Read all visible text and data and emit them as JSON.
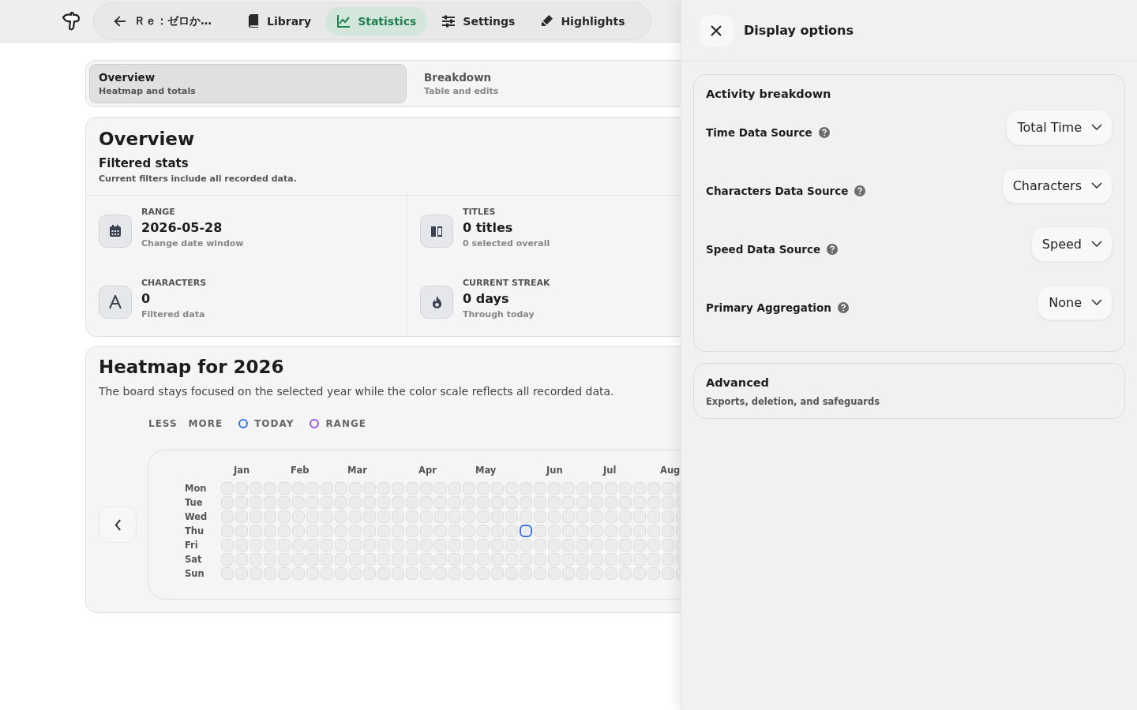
{
  "nav": {
    "back_title": "Ｒｅ：ゼロか…",
    "items": [
      {
        "label": "Library",
        "selected": false
      },
      {
        "label": "Statistics",
        "selected": true
      },
      {
        "label": "Settings",
        "selected": false
      },
      {
        "label": "Highlights",
        "selected": false
      }
    ]
  },
  "view_tabs": [
    {
      "title": "Overview",
      "subtitle": "Heatmap and totals",
      "selected": true
    },
    {
      "title": "Breakdown",
      "subtitle": "Table and edits",
      "selected": false
    }
  ],
  "overview": {
    "title": "Overview",
    "subtitle": "Filtered stats",
    "note": "Current filters include all recorded data.",
    "stats": [
      {
        "label": "RANGE",
        "value": "2026-05-28",
        "caption": "Change date window"
      },
      {
        "label": "TITLES",
        "value": "0 titles",
        "caption": "0 selected overall"
      },
      {
        "label": "CHARACTERS",
        "value": "0",
        "caption": "Filtered data"
      },
      {
        "label": "CURRENT STREAK",
        "value": "0 days",
        "caption": "Through today"
      }
    ]
  },
  "heatmap": {
    "title": "Heatmap for 2026",
    "description": "The board stays focused on the selected year while the color scale reflects all recorded data.",
    "legend": [
      {
        "label": "LESS",
        "kind": "text"
      },
      {
        "label": "MORE",
        "kind": "text"
      },
      {
        "label": "TODAY",
        "kind": "ring",
        "color": "#3b6fe8"
      },
      {
        "label": "RANGE",
        "kind": "ring",
        "color": "#9b59e0"
      }
    ],
    "months": [
      "Jan",
      "Feb",
      "Mar",
      "Apr",
      "May",
      "Jun",
      "Jul",
      "Aug"
    ],
    "days": [
      "Mon",
      "Tue",
      "Wed",
      "Thu",
      "Fri",
      "Sat",
      "Sun"
    ],
    "weeks": [
      {
        "today": [
          false,
          false,
          false,
          false,
          false,
          false,
          false
        ]
      },
      {
        "today": [
          false,
          false,
          false,
          false,
          false,
          false,
          false
        ]
      },
      {
        "today": [
          false,
          false,
          false,
          false,
          false,
          false,
          false
        ]
      },
      {
        "today": [
          false,
          false,
          false,
          false,
          false,
          false,
          false
        ]
      },
      {
        "today": [
          false,
          false,
          false,
          false,
          false,
          false,
          false
        ]
      },
      {
        "today": [
          false,
          false,
          false,
          false,
          false,
          false,
          false
        ]
      },
      {
        "today": [
          false,
          false,
          false,
          false,
          false,
          false,
          false
        ]
      },
      {
        "today": [
          false,
          false,
          false,
          false,
          false,
          false,
          false
        ]
      },
      {
        "today": [
          false,
          false,
          false,
          false,
          false,
          false,
          false
        ]
      },
      {
        "today": [
          false,
          false,
          false,
          false,
          false,
          false,
          false
        ]
      },
      {
        "today": [
          false,
          false,
          false,
          false,
          false,
          false,
          false
        ]
      },
      {
        "today": [
          false,
          false,
          false,
          false,
          false,
          false,
          false
        ]
      },
      {
        "today": [
          false,
          false,
          false,
          false,
          false,
          false,
          false
        ]
      },
      {
        "today": [
          false,
          false,
          false,
          false,
          false,
          false,
          false
        ]
      },
      {
        "today": [
          false,
          false,
          false,
          false,
          false,
          false,
          false
        ]
      },
      {
        "today": [
          false,
          false,
          false,
          false,
          false,
          false,
          false
        ]
      },
      {
        "today": [
          false,
          false,
          false,
          false,
          false,
          false,
          false
        ]
      },
      {
        "today": [
          false,
          false,
          false,
          false,
          false,
          false,
          false
        ]
      },
      {
        "today": [
          false,
          false,
          false,
          false,
          false,
          false,
          false
        ]
      },
      {
        "today": [
          false,
          false,
          false,
          false,
          false,
          false,
          false
        ]
      },
      {
        "today": [
          false,
          false,
          false,
          false,
          false,
          false,
          false
        ]
      },
      {
        "today": [
          false,
          false,
          false,
          true,
          false,
          false,
          false
        ]
      },
      {
        "today": [
          false,
          false,
          false,
          false,
          false,
          false,
          false
        ]
      },
      {
        "today": [
          false,
          false,
          false,
          false,
          false,
          false,
          false
        ]
      },
      {
        "today": [
          false,
          false,
          false,
          false,
          false,
          false,
          false
        ]
      },
      {
        "today": [
          false,
          false,
          false,
          false,
          false,
          false,
          false
        ]
      },
      {
        "today": [
          false,
          false,
          false,
          false,
          false,
          false,
          false
        ]
      },
      {
        "today": [
          false,
          false,
          false,
          false,
          false,
          false,
          false
        ]
      },
      {
        "today": [
          false,
          false,
          false,
          false,
          false,
          false,
          false
        ]
      },
      {
        "today": [
          false,
          false,
          false,
          false,
          false,
          false,
          false
        ]
      },
      {
        "today": [
          false,
          false,
          false,
          false,
          false,
          false,
          false
        ]
      },
      {
        "today": [
          false,
          false,
          false,
          false,
          false,
          false,
          false
        ]
      },
      {
        "today": [
          false,
          false,
          false,
          false,
          false,
          false,
          false
        ]
      }
    ]
  },
  "panel": {
    "title": "Display options",
    "sections": [
      {
        "title": "Activity breakdown",
        "options": [
          {
            "label": "Time Data Source",
            "value": "Total Time"
          },
          {
            "label": "Characters Data Source",
            "value": "Characters"
          },
          {
            "label": "Speed Data Source",
            "value": "Speed"
          },
          {
            "label": "Primary Aggregation",
            "value": "None"
          }
        ]
      },
      {
        "title": "Advanced",
        "subtitle": "Exports, deletion, and safeguards"
      }
    ]
  }
}
